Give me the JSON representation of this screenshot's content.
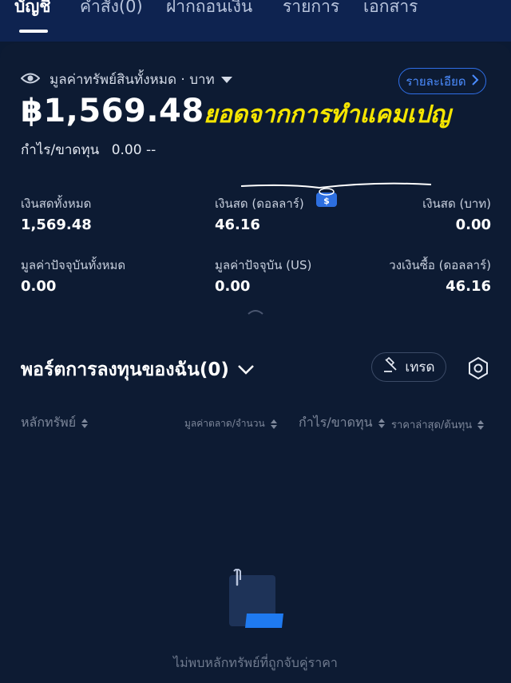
{
  "tabs": [
    {
      "label": "บัญชี"
    },
    {
      "label": "คำสั่ง(0)"
    },
    {
      "label": "ฝากถอนเงิน"
    },
    {
      "label": "รายการ"
    },
    {
      "label": "เอกสาร"
    }
  ],
  "asset": {
    "label": "มูลค่าทรัพย์สินทั้งหมด · บาท",
    "detail_button": "รายละเอียด",
    "total_balance": "฿1,569.48",
    "overlay_note": "ยอดจากการทำแคมเปญ",
    "pnl_label": "กำไร/ขาดทุน",
    "pnl_value": "0.00 --"
  },
  "stats": [
    {
      "label": "เงินสดทั้งหมด",
      "value": "1,569.48"
    },
    {
      "label": "เงินสด (ดอลลาร์)",
      "value": "46.16"
    },
    {
      "label": "เงินสด (บาท)",
      "value": "0.00"
    },
    {
      "label": "มูลค่าปัจจุบันทั้งหมด",
      "value": "0.00"
    },
    {
      "label": "มูลค่าปัจจุบัน (US)",
      "value": "0.00"
    },
    {
      "label": "วงเงินซื้อ (ดอลลาร์)",
      "value": "46.16"
    }
  ],
  "portfolio": {
    "title": "พอร์ตการลงทุนของฉัน(0)",
    "trade_button": "เทรด",
    "columns": {
      "security": "หลักทรัพย์",
      "market_value": "มูลค่าตลาด/จำนวน",
      "pnl": "กำไร/ขาดทุน",
      "price": "ราคาล่าสุด/ต้นทุน"
    },
    "empty_message": "ไม่พบหลักทรัพย์ที่ถูกจับคู่ราคา"
  },
  "colors": {
    "background": "#0b1a33",
    "accent": "#2f6fe8",
    "overlay_text": "#f5e500"
  },
  "icons": [
    "eye-icon",
    "chevron-right-icon",
    "chevron-down-icon",
    "gavel-icon",
    "settings-hex-icon",
    "empty-document-icon",
    "money-bag-icon"
  ]
}
